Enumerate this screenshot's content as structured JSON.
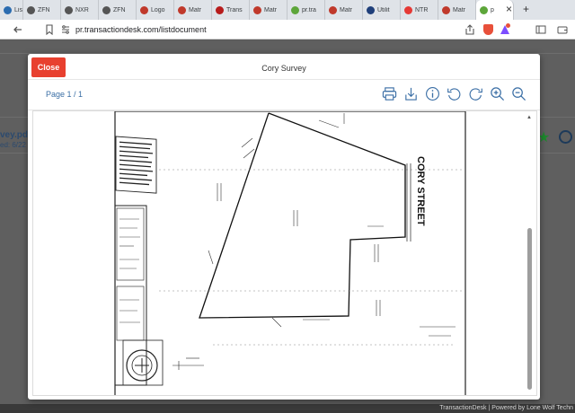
{
  "browser": {
    "tabs": [
      {
        "label": "Listi",
        "color": "#2b6cb0"
      },
      {
        "label": "ZFN",
        "color": "#555555"
      },
      {
        "label": "NXR",
        "color": "#555555"
      },
      {
        "label": "ZFN",
        "color": "#555555"
      },
      {
        "label": "Logo",
        "color": "#c0392b"
      },
      {
        "label": "Matr",
        "color": "#c0392b"
      },
      {
        "label": "Trans",
        "color": "#b71c1c"
      },
      {
        "label": "Matr",
        "color": "#c0392b"
      },
      {
        "label": "pr.tra",
        "color": "#5da63a"
      },
      {
        "label": "Matr",
        "color": "#c0392b"
      },
      {
        "label": "Utilit",
        "color": "#1f3f7a"
      },
      {
        "label": "NTR",
        "color": "#e53935"
      },
      {
        "label": "Matr",
        "color": "#c0392b"
      },
      {
        "label": "p",
        "color": "#5da63a"
      }
    ],
    "tab_close": "×",
    "new_tab": "+",
    "url": "pr.transactiondesk.com/listdocument",
    "shield_color": "#e8503a",
    "alert_color": "#e8503a"
  },
  "background_page": {
    "file_title": "vey.pdf",
    "file_sub": "ed: 6/22",
    "footer": "TransactionDesk | Powered by Lone Wolf Techn"
  },
  "modal": {
    "close_label": "Close",
    "title": "Cory Survey",
    "page_indicator": "Page 1 / 1",
    "toolbar_icons": [
      "print-icon",
      "download-icon",
      "info-icon",
      "rotate-left-icon",
      "rotate-right-icon",
      "zoom-in-icon",
      "zoom-out-icon"
    ],
    "accent_color": "#3a6ea5",
    "close_color": "#e8402f"
  },
  "document": {
    "street_label": "CORY STREET"
  }
}
